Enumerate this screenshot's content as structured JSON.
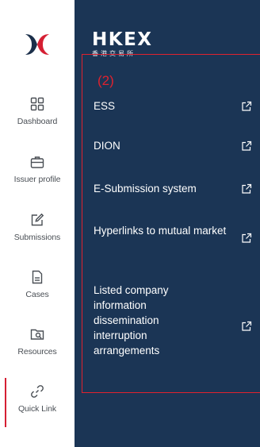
{
  "brand": {
    "logo_mark": "hkex-x-logo",
    "name": "HKEX",
    "subtitle": "香港交易所"
  },
  "rail": {
    "items": [
      {
        "id": "dashboard",
        "label": "Dashboard",
        "icon": "grid-icon"
      },
      {
        "id": "issuer-profile",
        "label": "Issuer profile",
        "icon": "briefcase-icon"
      },
      {
        "id": "submissions",
        "label": "Submissions",
        "icon": "edit-icon"
      },
      {
        "id": "cases",
        "label": "Cases",
        "icon": "document-icon"
      },
      {
        "id": "resources",
        "label": "Resources",
        "icon": "folder-search-icon"
      },
      {
        "id": "quick-link",
        "label": "Quick Link",
        "icon": "link-icon",
        "active": true
      }
    ]
  },
  "panel": {
    "annotation": "(2)",
    "links": [
      {
        "label": "ESS",
        "icon": "external-link-icon"
      },
      {
        "label": "DION",
        "icon": "external-link-icon"
      },
      {
        "label": "E-Submission system",
        "icon": "external-link-icon"
      },
      {
        "label": "Hyperlinks to mutual market",
        "icon": "external-link-icon"
      },
      {
        "label": "Listed company information dissemination interruption arrangements",
        "icon": "external-link-icon"
      }
    ]
  },
  "colors": {
    "panel_bg": "#1b3555",
    "accent_red": "#d51f33",
    "logo_navy": "#1b2f4a",
    "annotation_red": "#e0222e"
  }
}
